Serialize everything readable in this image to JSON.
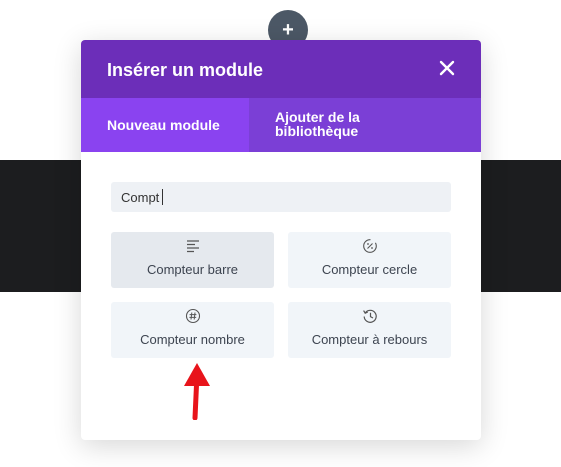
{
  "modal": {
    "title": "Insérer un module",
    "close_icon": "close-icon",
    "tabs": [
      {
        "label": "Nouveau module",
        "active": true
      },
      {
        "label": "Ajouter de la bibliothèque",
        "active": false
      }
    ]
  },
  "search": {
    "value": "Compt",
    "placeholder": ""
  },
  "modules": [
    {
      "label": "Compteur barre",
      "icon": "align-left-icon"
    },
    {
      "label": "Compteur cercle",
      "icon": "circle-percent-icon"
    },
    {
      "label": "Compteur nombre",
      "icon": "hash-circle-icon"
    },
    {
      "label": "Compteur à rebours",
      "icon": "history-clock-icon"
    }
  ],
  "colors": {
    "header": "#6c2eb9",
    "tabs_bar": "#7b3fd6",
    "active_tab": "#8a43f0",
    "annotation_arrow": "#e8141b"
  }
}
